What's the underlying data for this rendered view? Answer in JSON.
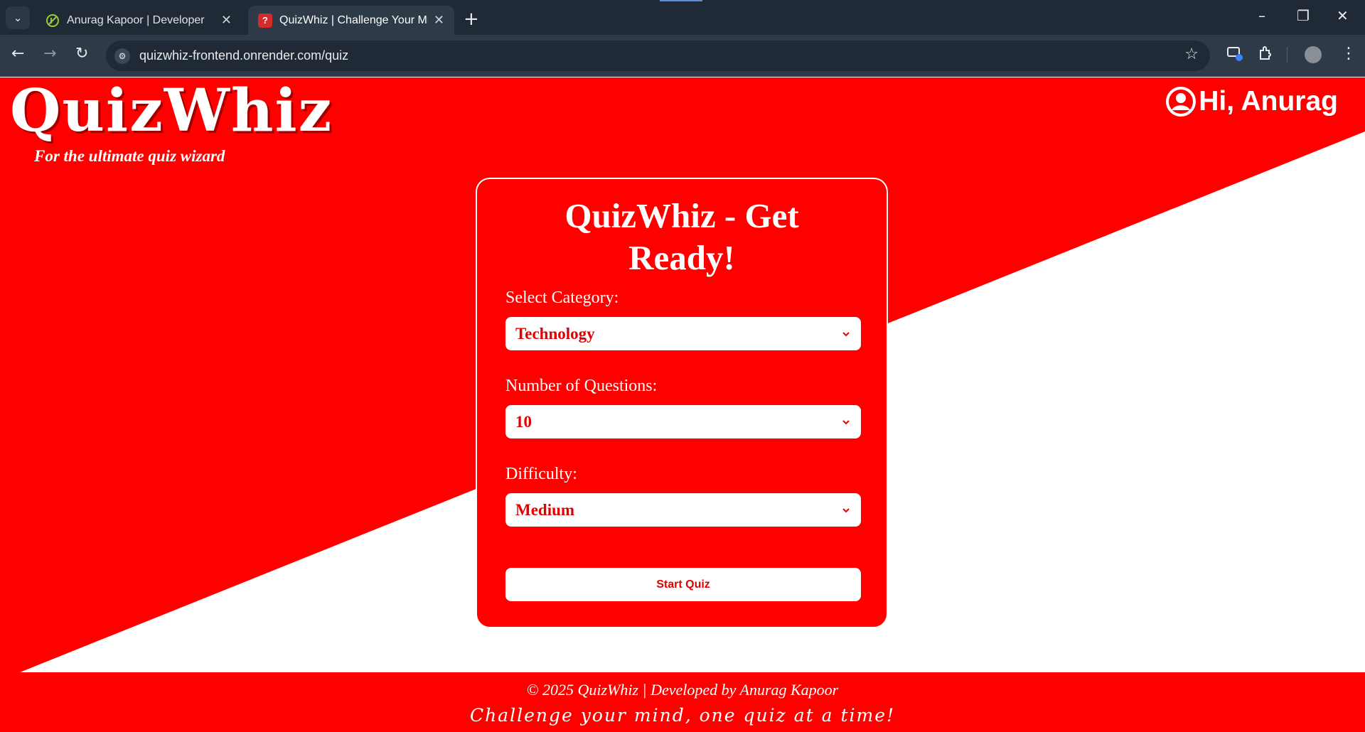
{
  "browser": {
    "tabs": [
      {
        "title": "Anurag Kapoor | Developer",
        "active": false
      },
      {
        "title": "QuizWhiz | Challenge Your Mind",
        "active": true
      }
    ],
    "new_tab": "+",
    "url": "quizwhiz-frontend.onrender.com/quiz"
  },
  "header": {
    "logo": "QuizWhiz",
    "tagline": "For the ultimate quiz wizard",
    "greeting": "Hi, Anurag"
  },
  "card": {
    "title_line1": "QuizWhiz - Get",
    "title_line2": "Ready!",
    "category_label": "Select Category:",
    "category_value": "Technology",
    "questions_label": "Number of Questions:",
    "questions_value": "10",
    "difficulty_label": "Difficulty:",
    "difficulty_value": "Medium",
    "start_label": "Start Quiz"
  },
  "footer": {
    "copyright": "© 2025 QuizWhiz | Developed by Anurag Kapoor",
    "motto": "Challenge your mind, one quiz at a time!"
  },
  "colors": {
    "brand_red": "#ff0000",
    "chrome_dark": "#1f2a36",
    "chrome_toolbar": "#2e3a47"
  }
}
